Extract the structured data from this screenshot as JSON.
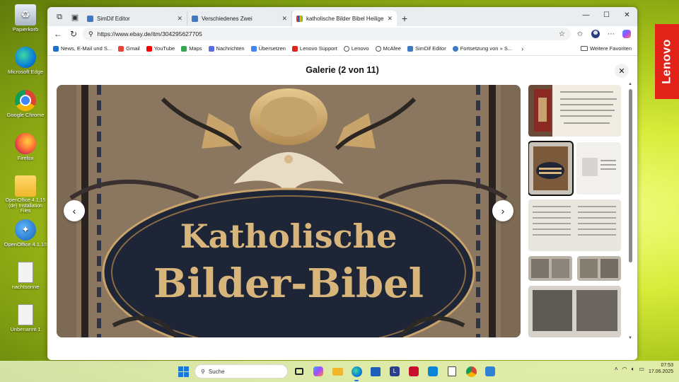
{
  "desktop": {
    "icons": [
      {
        "label": "Papierkorb",
        "icon": "recycle-bin-icon"
      },
      {
        "label": "Microsoft Edge",
        "icon": "edge-icon"
      },
      {
        "label": "Google Chrome",
        "icon": "chrome-icon"
      },
      {
        "label": "Firefox",
        "icon": "firefox-icon"
      },
      {
        "label": "OpenOffice 4.1.15 (de) Installation Files",
        "icon": "folder-icon"
      },
      {
        "label": "OpenOffice 4.1.15",
        "icon": "openoffice-icon"
      },
      {
        "label": "nachtsonne",
        "icon": "image-file-icon"
      },
      {
        "label": "Unbenannt 1",
        "icon": "document-file-icon"
      }
    ]
  },
  "browser": {
    "tabs": [
      {
        "title": "SimDif Editor",
        "active": false
      },
      {
        "title": "Verschiedenes Zwei",
        "active": false
      },
      {
        "title": "katholische Bilder Bibel Heilige S",
        "active": true
      }
    ],
    "url": "https://www.ebay.de/itm/304295627705",
    "favorites": [
      {
        "label": "News, E-Mail und S...",
        "color": "#1f6fd1"
      },
      {
        "label": "Gmail",
        "color": "#ea4335"
      },
      {
        "label": "YouTube",
        "color": "#ff0000"
      },
      {
        "label": "Maps",
        "color": "#34a853"
      },
      {
        "label": "Nachrichten",
        "color": "#5b6ee1"
      },
      {
        "label": "Übersetzen",
        "color": "#4285f4"
      },
      {
        "label": "Lenovo Support",
        "color": "#e2231a"
      },
      {
        "label": "Lenovo",
        "color": "#555555"
      },
      {
        "label": "McAfee",
        "color": "#555555"
      },
      {
        "label": "SimDif Editor",
        "color": "#3d7ac2"
      },
      {
        "label": "Fortsetzung von » S...",
        "color": "#3d7ac2"
      }
    ],
    "favorites_other": "Weitere Favoriten"
  },
  "gallery": {
    "title": "Galerie (2 von 11)",
    "main_image_text": [
      "Katholische",
      "Bilder-Bibel"
    ],
    "current_index": 2,
    "total": 11
  },
  "lenovo_tab": "Lenovo",
  "taskbar": {
    "search_placeholder": "Suche",
    "time": "07:53",
    "date": "17.06.2025"
  }
}
